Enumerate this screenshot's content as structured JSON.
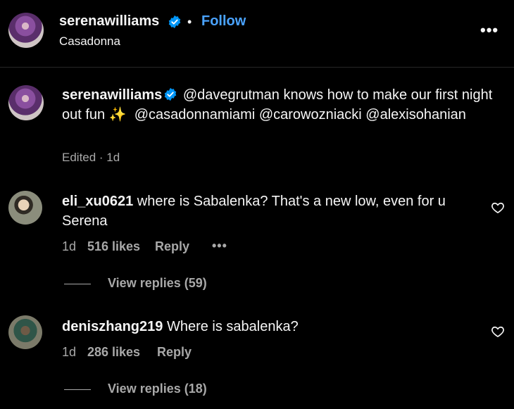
{
  "post": {
    "username": "serenawilliams",
    "follow_label": "Follow",
    "separator": "•",
    "location": "Casadonna",
    "more_label": "•••"
  },
  "caption": {
    "username": "serenawilliams",
    "text_1": "@davegrutman knows how to make our first night out fun ",
    "emoji": "✨",
    "mention_1": "@casadonnamiami",
    "mention_2": "@carowozniacki",
    "mention_3": "@alexisohanian",
    "meta": "Edited · 1d"
  },
  "comments": [
    {
      "username": "eli_xu0621",
      "text": "where is Sabalenka? That's a new low, even for u Serena",
      "time": "1d",
      "likes": "516 likes",
      "reply_label": "Reply",
      "more_label": "•••",
      "view_replies": "View replies (59)"
    },
    {
      "username": "deniszhang219",
      "text": "Where is sabalenka?",
      "time": "1d",
      "likes": "286 likes",
      "reply_label": "Reply",
      "view_replies": "View replies (18)"
    }
  ],
  "icons": {
    "verified": "verified-badge-icon",
    "heart": "heart-outline-icon",
    "accent": "#4aa3ff"
  }
}
